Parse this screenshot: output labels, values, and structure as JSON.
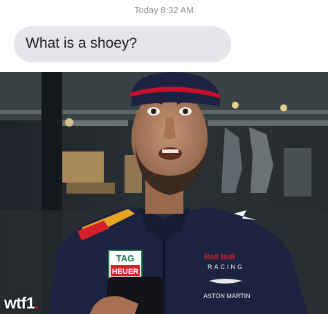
{
  "conversation": {
    "timestamp": "Today 8:32 AM",
    "message": "What is a shoey?"
  },
  "photo": {
    "description_icon": "person-reaction-photo",
    "cap_brand": "",
    "sponsors": {
      "tag_heuer_line1": "TAG",
      "tag_heuer_line2": "HEUER",
      "redbull": "Red Bull",
      "racing": "RACING",
      "aston_martin": "ASTON MARTIN"
    }
  },
  "watermark": {
    "brand": "wtf1",
    "dot": "."
  },
  "colors": {
    "bubble": "#e5e5ea",
    "timestamp": "#8e8e93",
    "jacket": "#1b2340",
    "accent_red": "#e10600"
  }
}
